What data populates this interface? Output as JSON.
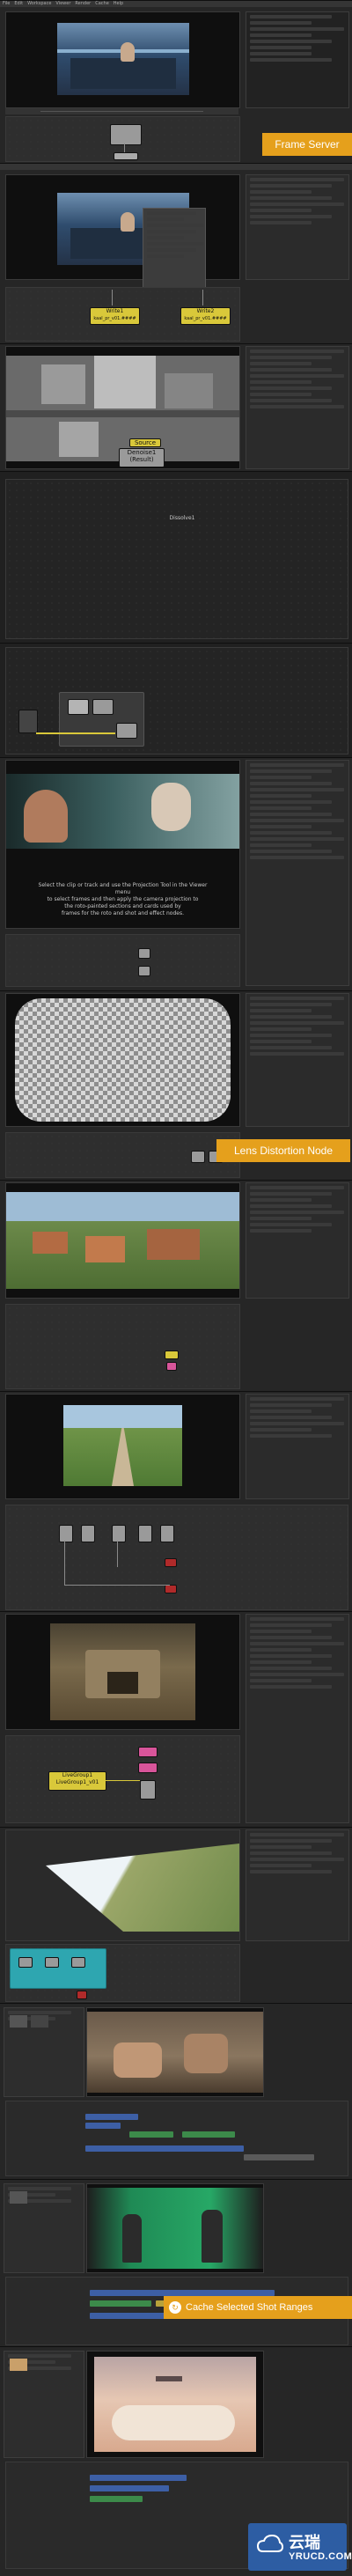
{
  "menubar": {
    "items": [
      "File",
      "Edit",
      "Workspace",
      "Viewer",
      "Render",
      "Cache",
      "Help"
    ]
  },
  "badges": {
    "frame_server": "Frame Server",
    "lens_distortion": "Lens Distortion Node",
    "cache_ranges": "Cache Selected Shot Ranges"
  },
  "nodes": {
    "write1": "Write1",
    "write1_file": "kaal_pr_v01.####",
    "write2": "Write2",
    "write2_file": "kaal_pr_v01.####",
    "source": "Source",
    "denoise_line1": "Denoise1",
    "denoise_line2": "(Result)",
    "livegroup_line1": "LiveGroup1",
    "livegroup_line2": "LiveGroup1_v01"
  },
  "center_label": "Dissolve1",
  "overlay_lines": [
    "Select the clip or track and use the Projection Tool in the Viewer menu",
    "to select frames and then apply the camera projection to",
    "the roto-painted sections and cards used by",
    "frames for the roto and shot and effect nodes."
  ],
  "watermark": {
    "cn": "云瑞",
    "en": "YRUCD.COM"
  },
  "colors": {
    "accent": "#e5a01c",
    "node_yellow": "#d9c83a",
    "node_grey": "#9a9a9a",
    "node_pink": "#d8559a",
    "node_red": "#b02a2a",
    "teal": "#2ea6b0",
    "watermark_blue": "#2d5da3"
  }
}
